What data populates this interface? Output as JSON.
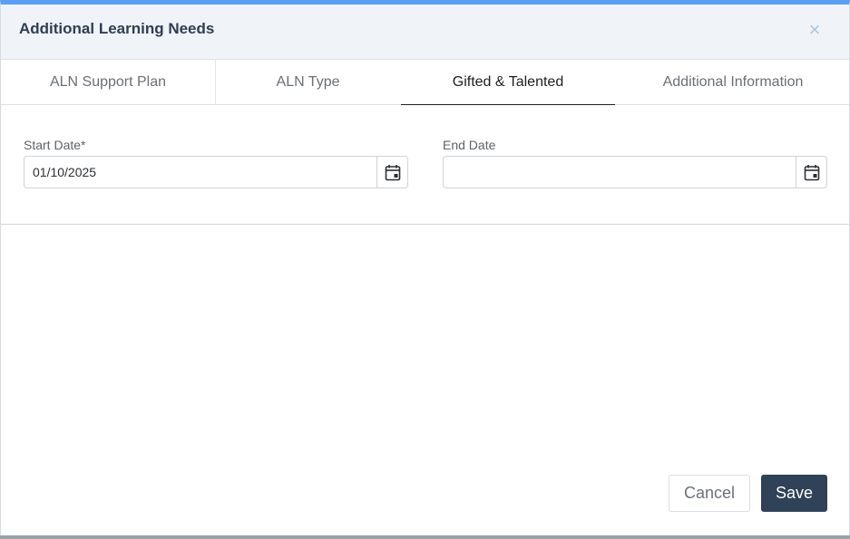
{
  "modal": {
    "title": "Additional Learning Needs",
    "close_icon": "×"
  },
  "tabs": [
    {
      "label": "ALN Support Plan",
      "active": false
    },
    {
      "label": "ALN Type",
      "active": false
    },
    {
      "label": "Gifted & Talented",
      "active": true
    },
    {
      "label": "Additional Information",
      "active": false
    }
  ],
  "form": {
    "start_date": {
      "label": "Start Date*",
      "value": "01/10/2025"
    },
    "end_date": {
      "label": "End Date",
      "value": ""
    }
  },
  "footer": {
    "cancel_label": "Cancel",
    "save_label": "Save"
  },
  "colors": {
    "accent_top": "#5b9ef5",
    "primary_button": "#2f4257"
  },
  "icons": {
    "close": "close-icon",
    "calendar": "calendar-icon"
  }
}
